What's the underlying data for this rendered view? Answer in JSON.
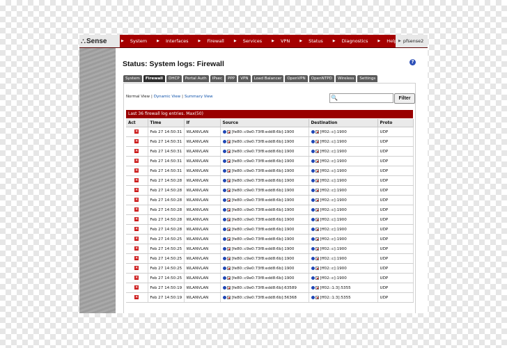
{
  "brand": {
    "logo_mark": "⛬",
    "logo_text": "Sense",
    "host": "pfsense2"
  },
  "nav": [
    "System",
    "Interfaces",
    "Firewall",
    "Services",
    "VPN",
    "Status",
    "Diagnostics",
    "Help"
  ],
  "page": {
    "title": "Status: System logs: Firewall",
    "help": "?"
  },
  "tabs": [
    {
      "label": "System"
    },
    {
      "label": "Firewall"
    },
    {
      "label": "DHCP"
    },
    {
      "label": "Portal Auth"
    },
    {
      "label": "IPsec"
    },
    {
      "label": "PPP"
    },
    {
      "label": "VPN"
    },
    {
      "label": "Load Balancer"
    },
    {
      "label": "OpenVPN"
    },
    {
      "label": "OpenNTPD"
    },
    {
      "label": "Wireless"
    },
    {
      "label": "Settings"
    }
  ],
  "active_tab": "Firewall",
  "views": {
    "normal": "Normal View",
    "dynamic": "Dynamic View",
    "summary": "Summary View",
    "separator": "|"
  },
  "filter": {
    "value": "",
    "button": "Filter"
  },
  "log": {
    "header": "Last 36 firewall log entries. Max(50)",
    "columns": [
      "Act",
      "Time",
      "If",
      "Source",
      "Destination",
      "Proto"
    ],
    "rows": [
      {
        "time": "Feb 27 14:50:31",
        "if": "WLANVLAN",
        "source": "[fe80::c9e0:73f8:edd8:6b]:1900",
        "destination": "[ff02::c]:1900",
        "proto": "UDP"
      },
      {
        "time": "Feb 27 14:50:31",
        "if": "WLANVLAN",
        "source": "[fe80::c9e0:73f8:edd8:6b]:1900",
        "destination": "[ff02::c]:1900",
        "proto": "UDP"
      },
      {
        "time": "Feb 27 14:50:31",
        "if": "WLANVLAN",
        "source": "[fe80::c9e0:73f8:edd8:6b]:1900",
        "destination": "[ff02::c]:1900",
        "proto": "UDP"
      },
      {
        "time": "Feb 27 14:50:31",
        "if": "WLANVLAN",
        "source": "[fe80::c9e0:73f8:edd8:6b]:1900",
        "destination": "[ff02::c]:1900",
        "proto": "UDP"
      },
      {
        "time": "Feb 27 14:50:31",
        "if": "WLANVLAN",
        "source": "[fe80::c9e0:73f8:edd8:6b]:1900",
        "destination": "[ff02::c]:1900",
        "proto": "UDP"
      },
      {
        "time": "Feb 27 14:50:28",
        "if": "WLANVLAN",
        "source": "[fe80::c9e0:73f8:edd8:6b]:1900",
        "destination": "[ff02::c]:1900",
        "proto": "UDP"
      },
      {
        "time": "Feb 27 14:50:28",
        "if": "WLANVLAN",
        "source": "[fe80::c9e0:73f8:edd8:6b]:1900",
        "destination": "[ff02::c]:1900",
        "proto": "UDP"
      },
      {
        "time": "Feb 27 14:50:28",
        "if": "WLANVLAN",
        "source": "[fe80::c9e0:73f8:edd8:6b]:1900",
        "destination": "[ff02::c]:1900",
        "proto": "UDP"
      },
      {
        "time": "Feb 27 14:50:28",
        "if": "WLANVLAN",
        "source": "[fe80::c9e0:73f8:edd8:6b]:1900",
        "destination": "[ff02::c]:1900",
        "proto": "UDP"
      },
      {
        "time": "Feb 27 14:50:28",
        "if": "WLANVLAN",
        "source": "[fe80::c9e0:73f8:edd8:6b]:1900",
        "destination": "[ff02::c]:1900",
        "proto": "UDP"
      },
      {
        "time": "Feb 27 14:50:28",
        "if": "WLANVLAN",
        "source": "[fe80::c9e0:73f8:edd8:6b]:1900",
        "destination": "[ff02::c]:1900",
        "proto": "UDP"
      },
      {
        "time": "Feb 27 14:50:25",
        "if": "WLANVLAN",
        "source": "[fe80::c9e0:73f8:edd8:6b]:1900",
        "destination": "[ff02::c]:1900",
        "proto": "UDP"
      },
      {
        "time": "Feb 27 14:50:25",
        "if": "WLANVLAN",
        "source": "[fe80::c9e0:73f8:edd8:6b]:1900",
        "destination": "[ff02::c]:1900",
        "proto": "UDP"
      },
      {
        "time": "Feb 27 14:50:25",
        "if": "WLANVLAN",
        "source": "[fe80::c9e0:73f8:edd8:6b]:1900",
        "destination": "[ff02::c]:1900",
        "proto": "UDP"
      },
      {
        "time": "Feb 27 14:50:25",
        "if": "WLANVLAN",
        "source": "[fe80::c9e0:73f8:edd8:6b]:1900",
        "destination": "[ff02::c]:1900",
        "proto": "UDP"
      },
      {
        "time": "Feb 27 14:50:25",
        "if": "WLANVLAN",
        "source": "[fe80::c9e0:73f8:edd8:6b]:1900",
        "destination": "[ff02::c]:1900",
        "proto": "UDP"
      },
      {
        "time": "Feb 27 14:50:19",
        "if": "WLANVLAN",
        "source": "[fe80::c9e0:73f8:edd8:6b]:63589",
        "destination": "[ff02::1:3]:5355",
        "proto": "UDP"
      },
      {
        "time": "Feb 27 14:50:19",
        "if": "WLANVLAN",
        "source": "[fe80::c9e0:73f8:edd8:6b]:56368",
        "destination": "[ff02::1:3]:5355",
        "proto": "UDP"
      }
    ]
  },
  "icons": {
    "block": "block-icon",
    "info": "info-icon",
    "address": "address-icon",
    "search": "search-icon",
    "help": "help-icon"
  },
  "colors": {
    "nav_bg": "#a50000",
    "log_header_bg": "#990000",
    "block_icon": "#cc1a1a",
    "tab_bg": "#5b5b5b"
  }
}
